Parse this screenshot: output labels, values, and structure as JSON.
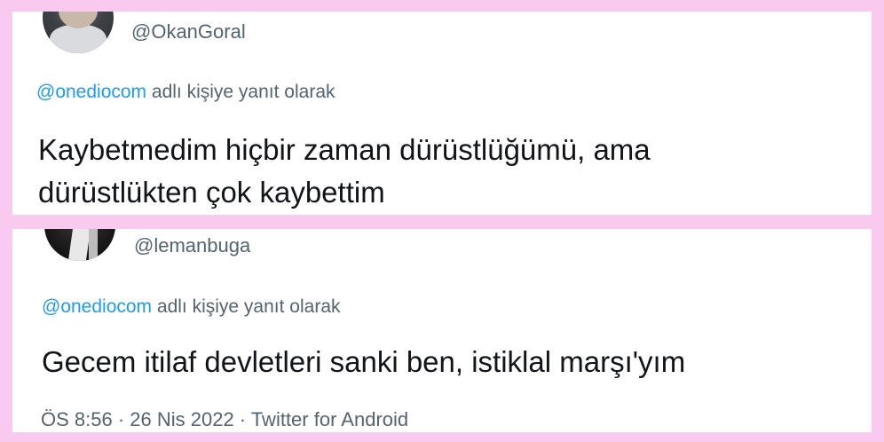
{
  "tweets": [
    {
      "handle": "@OkanGoral",
      "mention": "@onediocom",
      "reply_suffix": " adlı kişiye yanıt olarak",
      "line1": "Kaybetmedim hiçbir zaman dürüstlüğümü, ama",
      "line2": "dürüstlükten çok kaybettim"
    },
    {
      "handle": "@lemanbuga",
      "mention": "@onediocom",
      "reply_suffix": " adlı kişiye yanıt olarak",
      "line1": "Gecem itilaf devletleri sanki ben, istiklal marşı'yım",
      "meta": "ÖS 8:56 · 26 Nis 2022 · Twitter for Android"
    }
  ],
  "colors": {
    "border": "#f9c9ef",
    "mention": "#1d9bf0",
    "secondary_text": "#53636f",
    "primary_text": "#111418"
  }
}
